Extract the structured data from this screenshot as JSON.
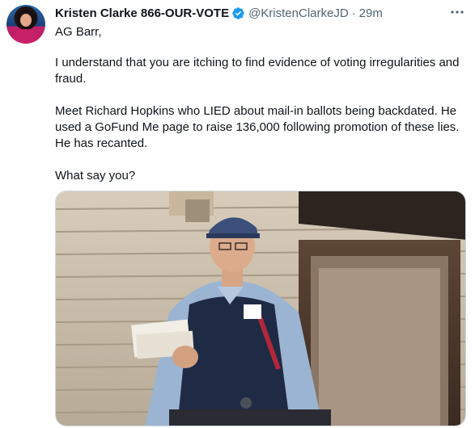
{
  "tweet": {
    "author_name": "Kristen Clarke 866-OUR-VOTE",
    "author_handle": "@KristenClarkeJD",
    "separator": "·",
    "timestamp": "29m",
    "paragraphs": [
      "AG Barr,",
      "I understand that you are itching to find evidence of voting irregularities and fraud.",
      "Meet Richard Hopkins who LIED about mail-in ballots being backdated. He used a GoFund Me page to raise 136,000 following promotion of these lies. He has recanted.",
      "What say you?"
    ]
  },
  "icons": {
    "verified": "verified-badge-icon",
    "more": "more-options-icon"
  },
  "colors": {
    "accent": "#1d9bf0",
    "secondary_text": "#536471",
    "primary_text": "#0f1419"
  }
}
